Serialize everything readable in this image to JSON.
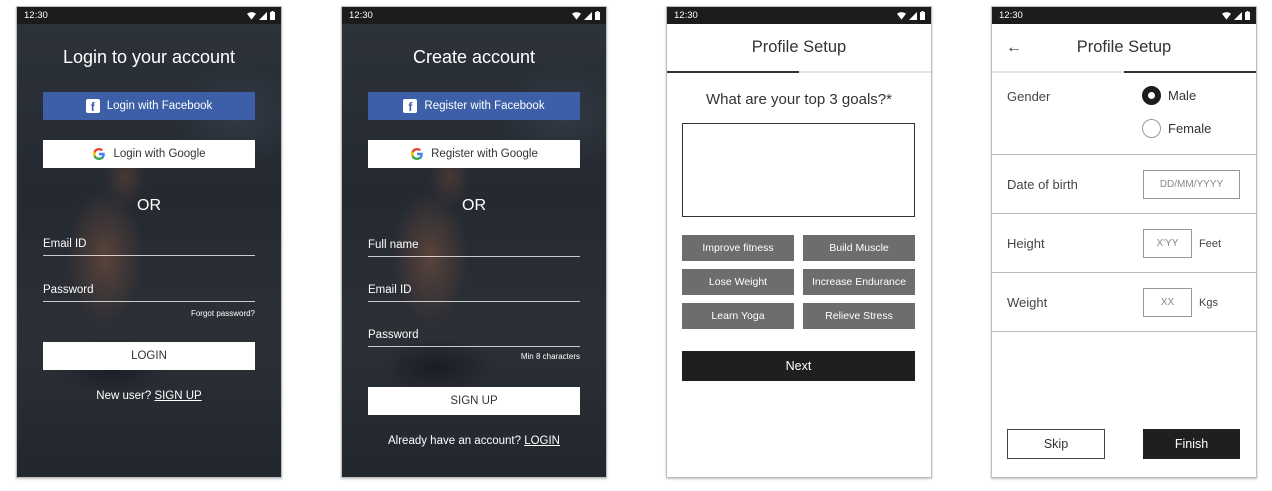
{
  "status_time": "12:30",
  "login": {
    "title": "Login to your account",
    "facebook_label": "Login with Facebook",
    "google_label": "Login with Google",
    "or_label": "OR",
    "email_label": "Email ID",
    "password_label": "Password",
    "forgot_label": "Forgot password?",
    "login_button": "LOGIN",
    "new_user_text": "New user?",
    "signup_link": "SIGN UP"
  },
  "register": {
    "title": "Create account",
    "facebook_label": "Register with Facebook",
    "google_label": "Register with Google",
    "or_label": "OR",
    "fullname_label": "Full name",
    "email_label": "Email ID",
    "password_label": "Password",
    "password_hint": "Min 8 characters",
    "signup_button": "SIGN UP",
    "have_account_text": "Already have an account?",
    "login_link": "LOGIN"
  },
  "goals": {
    "title": "Profile Setup",
    "progress": 0.5,
    "question": "What are your top 3 goals?*",
    "options": [
      "Improve fitness",
      "Build Muscle",
      "Lose Weight",
      "Increase Endurance",
      "Learn Yoga",
      "Relieve Stress"
    ],
    "next_button": "Next"
  },
  "profile": {
    "title": "Profile Setup",
    "progress": 1.0,
    "gender_label": "Gender",
    "gender_options": [
      "Male",
      "Female"
    ],
    "gender_selected": "Male",
    "dob_label": "Date of birth",
    "dob_placeholder": "DD/MM/YYYY",
    "height_label": "Height",
    "height_placeholder": "X'YY",
    "height_unit": "Feet",
    "weight_label": "Weight",
    "weight_placeholder": "XX",
    "weight_unit": "Kgs",
    "skip_button": "Skip",
    "finish_button": "Finish"
  },
  "colors": {
    "facebook": "#3c5fa8",
    "dark": "#1f1f1f",
    "chip": "#6d6d6d"
  }
}
